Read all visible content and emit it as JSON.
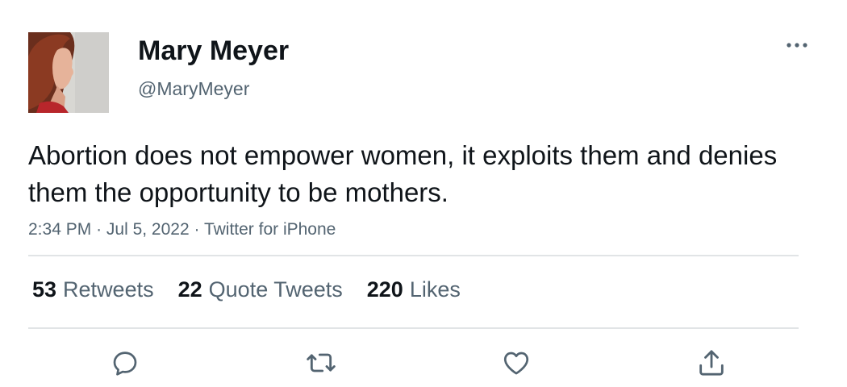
{
  "user": {
    "display_name": "Mary Meyer",
    "handle": "@MaryMeyer"
  },
  "tweet": {
    "text": "Abortion does not empower women, it exploits them and denies them the opportunity to be mothers.",
    "time": "2:34 PM",
    "date": "Jul 5, 2022",
    "source": "Twitter for iPhone",
    "separator": "·"
  },
  "stats": {
    "retweets": {
      "count": "53",
      "label": "Retweets"
    },
    "quote_tweets": {
      "count": "22",
      "label": "Quote Tweets"
    },
    "likes": {
      "count": "220",
      "label": "Likes"
    }
  },
  "actions": [
    "reply-icon",
    "retweet-icon",
    "like-icon",
    "share-icon"
  ],
  "icons": {
    "more": "more-horizontal-icon"
  },
  "colors": {
    "text_primary": "#0f1419",
    "text_secondary": "#536471",
    "divider": "#e1e4e6"
  }
}
